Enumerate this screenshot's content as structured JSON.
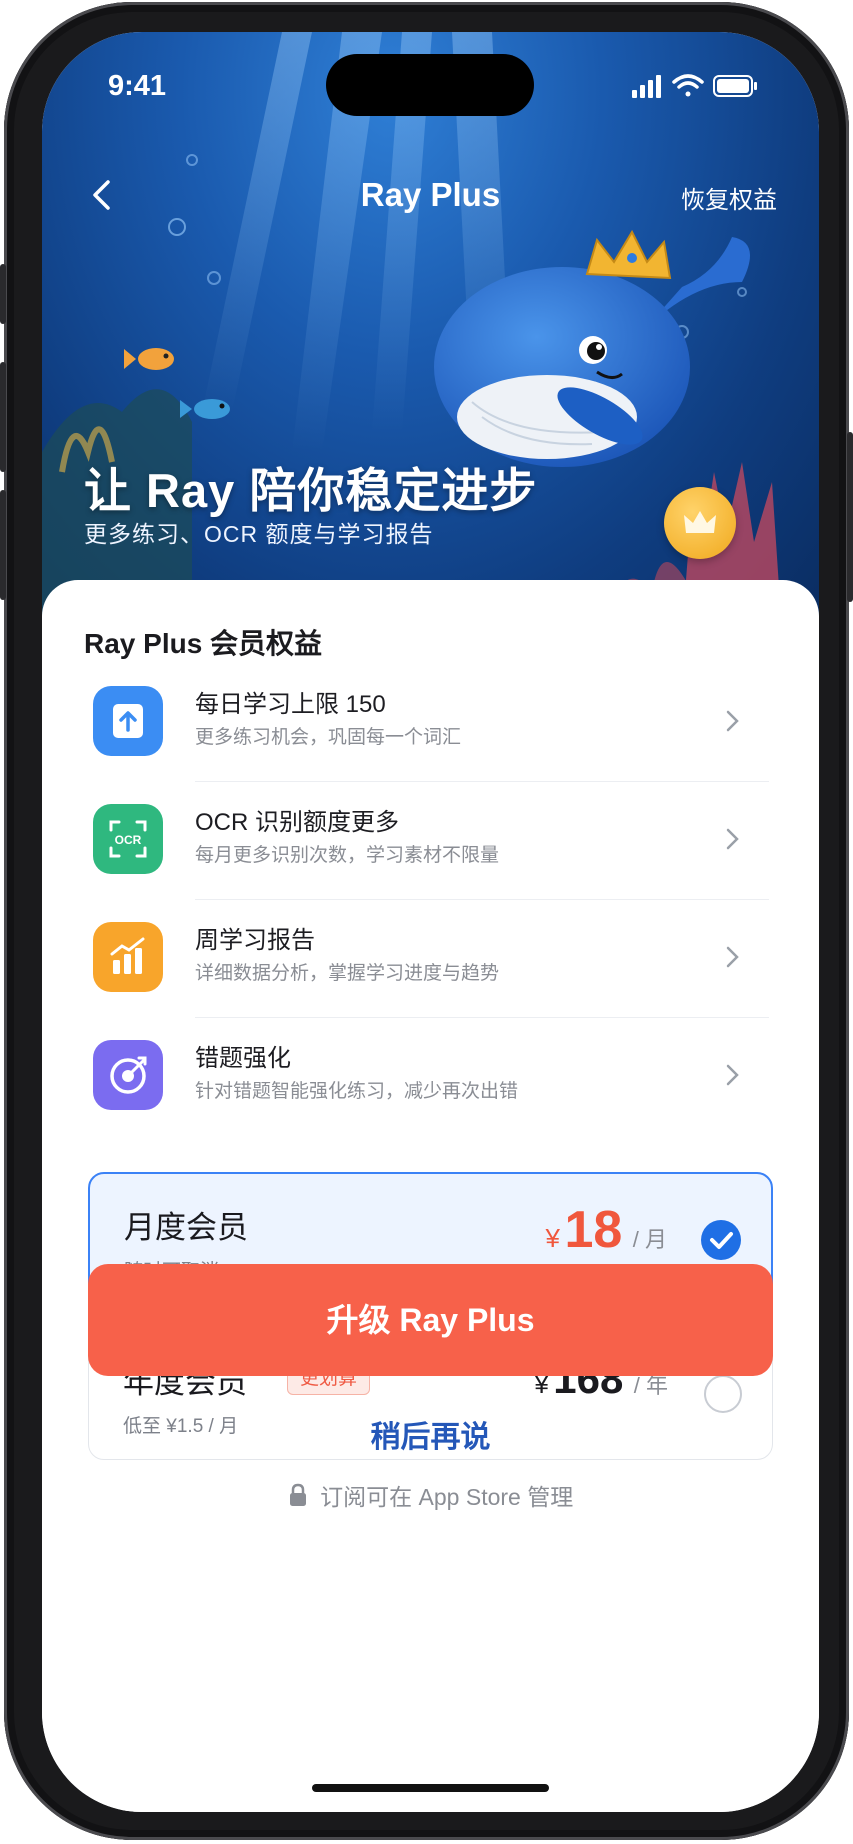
{
  "status_bar": {
    "time": "9:41"
  },
  "nav": {
    "title": "Ray Plus",
    "restore_label": "恢复权益"
  },
  "hero": {
    "title": "让 Ray 陪你稳定进步",
    "subtitle": "更多练习、OCR 额度与学习报告",
    "mascot": "crowned-whale"
  },
  "benefits": {
    "section_title": "Ray Plus 会员权益",
    "items": [
      {
        "title": "每日学习上限 150",
        "desc": "更多练习机会，巩固每一个词汇",
        "icon": "upload-icon",
        "color": "#3b8df3"
      },
      {
        "title": "OCR 识别额度更多",
        "desc": "每月更多识别次数，学习素材不限量",
        "icon": "ocr-icon",
        "color": "#2fb87f"
      },
      {
        "title": "周学习报告",
        "desc": "详细数据分析，掌握学习进度与趋势",
        "icon": "chart-icon",
        "color": "#f8a52b"
      },
      {
        "title": "错题强化",
        "desc": "针对错题智能强化练习，减少再次出错",
        "icon": "target-icon",
        "color": "#7b6cf0"
      }
    ]
  },
  "plans": [
    {
      "name": "月度会员",
      "sub": "随时可取消",
      "currency": "¥",
      "price": "18",
      "unit": "/ 月",
      "selected": true
    },
    {
      "name": "年度会员",
      "tag": "更划算",
      "sub": "低至 ¥1.5 / 月",
      "currency": "¥",
      "price": "168",
      "unit": "/ 年",
      "selected": false
    }
  ],
  "cta": {
    "label": "升级 Ray Plus"
  },
  "later": {
    "label": "稍后再说"
  },
  "footnote": {
    "text": "订阅可在 App Store 管理"
  },
  "colors": {
    "accent": "#f7614a",
    "selected_border": "#3b82f6",
    "link": "#2457b8"
  }
}
